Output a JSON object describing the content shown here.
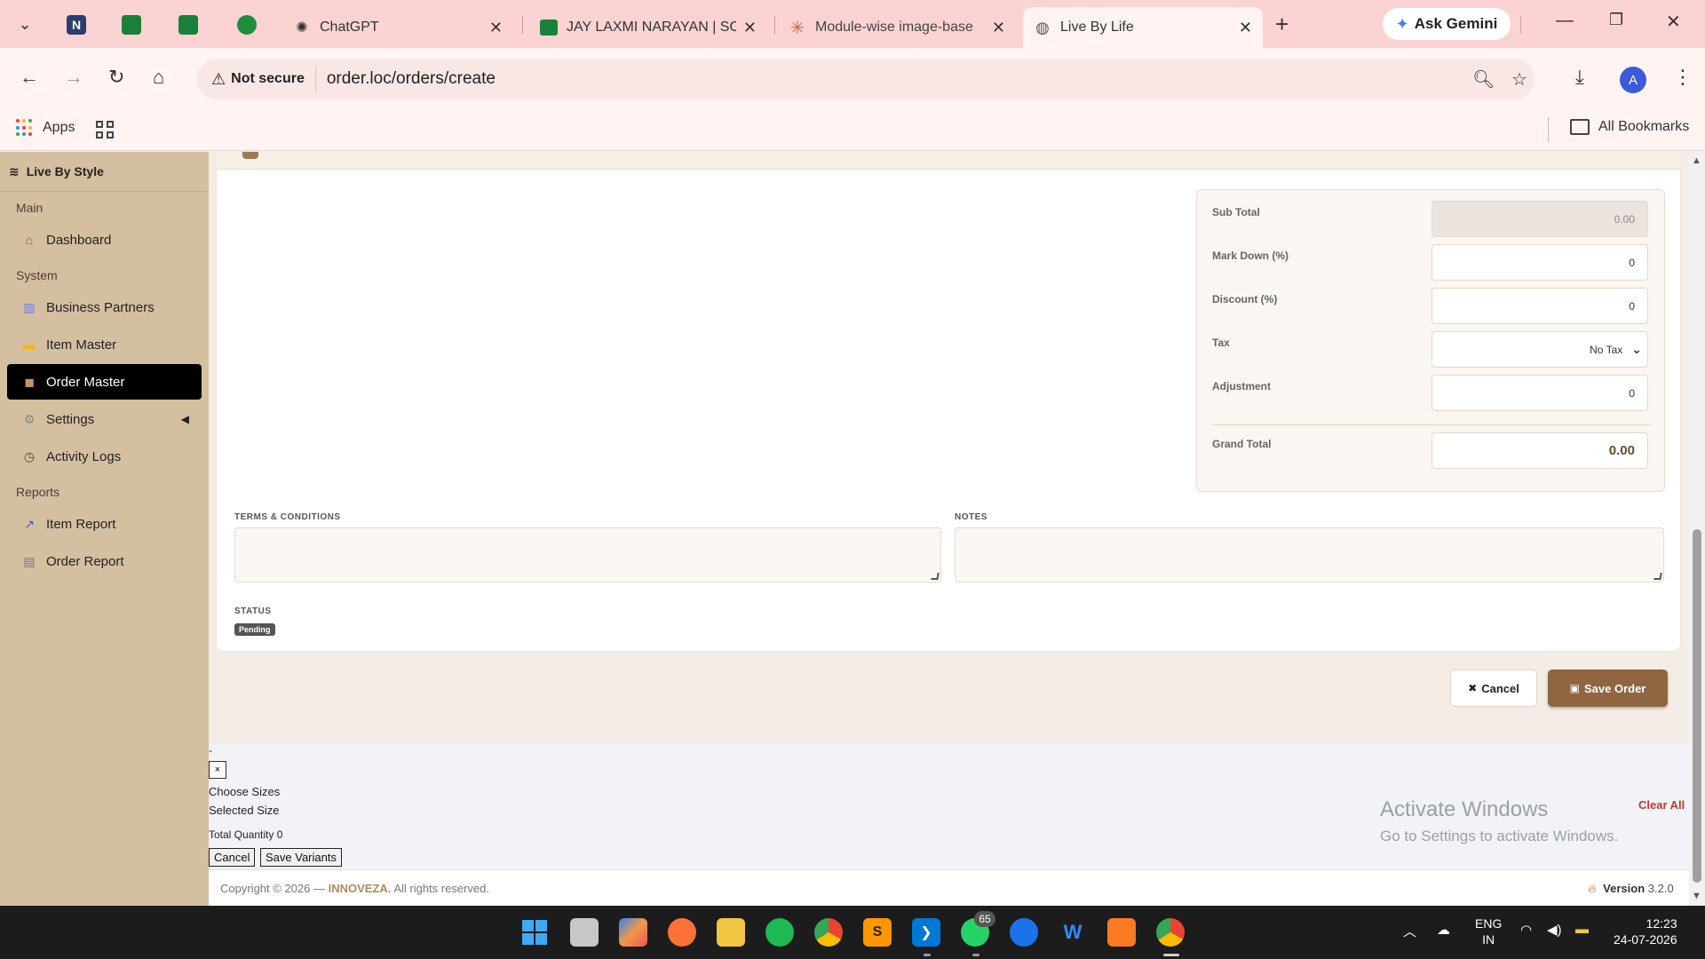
{
  "browser": {
    "tabs": [
      {
        "label": "ChatGPT",
        "close": "✕"
      },
      {
        "label": "JAY LAXMI NARAYAN | SO",
        "close": "✕"
      },
      {
        "label": "Module-wise image-base",
        "close": "✕"
      },
      {
        "label": "Live By Life",
        "close": "✕"
      }
    ],
    "new_tab": "+",
    "gemini_label": "Ask Gemini",
    "security_label": "Not secure",
    "url": "order.loc/orders/create",
    "profile_initial": "A",
    "bookmarks": {
      "apps_label": "Apps",
      "all_label": "All Bookmarks"
    }
  },
  "sidebar": {
    "brand": "Live By Style",
    "sections": {
      "main": "Main",
      "system": "System",
      "reports": "Reports"
    },
    "items": {
      "dashboard": "Dashboard",
      "business_partners": "Business Partners",
      "item_master": "Item Master",
      "order_master": "Order Master",
      "settings": "Settings",
      "activity_logs": "Activity Logs",
      "item_report": "Item Report",
      "order_report": "Order Report"
    }
  },
  "totals": {
    "subtotal_label": "Sub Total",
    "subtotal_value": "0.00",
    "markdown_label": "Mark Down (%)",
    "markdown_value": "0",
    "discount_label": "Discount (%)",
    "discount_value": "0",
    "tax_label": "Tax",
    "tax_value": "No Tax",
    "adjustment_label": "Adjustment",
    "adjustment_value": "0",
    "grand_label": "Grand Total",
    "grand_value": "0.00"
  },
  "form": {
    "terms_label": "TERMS & CONDITIONS",
    "notes_label": "NOTES",
    "status_label": "STATUS",
    "status_value": "Pending"
  },
  "actions": {
    "cancel": "Cancel",
    "save": "Save Order"
  },
  "variants": {
    "dash": "-",
    "close": "×",
    "choose_sizes": "Choose Sizes",
    "selected_size": "Selected Size",
    "total_quantity": "Total Quantity 0",
    "cancel": "Cancel",
    "save": "Save Variants",
    "clear_all": "Clear All"
  },
  "watermark": {
    "line1": "Activate Windows",
    "line2": "Go to Settings to activate Windows."
  },
  "footer": {
    "copy_prefix": "Copyright © 2026 —",
    "brand": "INNOVEZA.",
    "copy_suffix": "All rights reserved.",
    "version_label": "Version",
    "version_value": "3.2.0"
  },
  "taskbar": {
    "whatsapp_badge": "65",
    "lang_line1": "ENG",
    "lang_line2": "IN",
    "time": "12:23",
    "date": "24-07-2026"
  },
  "colors": {
    "accent": "#8f6641",
    "sidebar": "#d5bfa1",
    "active_nav": "#000000",
    "tabbar": "#fbd3d3"
  }
}
